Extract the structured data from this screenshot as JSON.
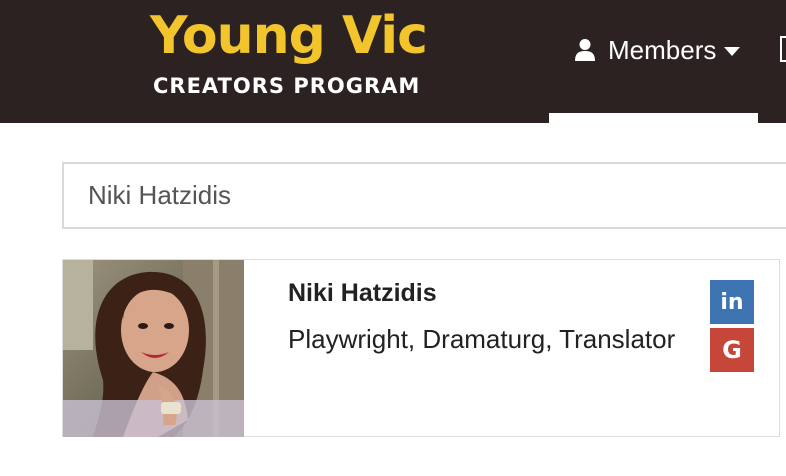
{
  "brand": {
    "title": "Young Vic",
    "subtitle": "CREATORS PROGRAM"
  },
  "nav": {
    "members_label": "Members",
    "icons": [
      "user-icon",
      "caret-down-icon"
    ]
  },
  "search": {
    "value": "Niki Hatzidis",
    "placeholder": ""
  },
  "profile": {
    "name": "Niki Hatzidis",
    "roles": "Playwright, Dramaturg, Translator",
    "social": {
      "linkedin": "in",
      "google": "G"
    }
  },
  "colors": {
    "header_bg": "#2b2221",
    "logo_yellow": "#f2c52c",
    "linkedin_blue": "#3f74b3",
    "google_red": "#c6463a"
  }
}
